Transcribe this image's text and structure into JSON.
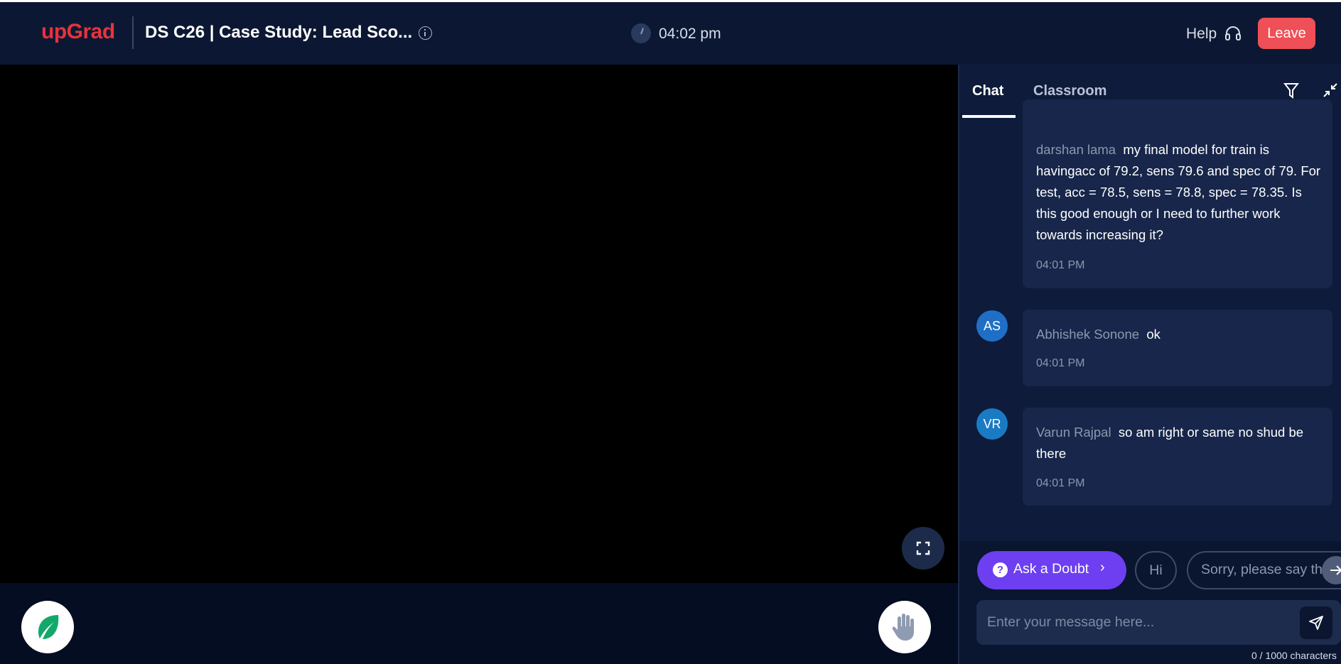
{
  "header": {
    "logo": "upGrad",
    "session_title": "DS C26 | Case Study: Lead Sco...",
    "clock_time": "04:02 pm",
    "help_label": "Help",
    "leave_label": "Leave"
  },
  "icons": {
    "info": "info-icon",
    "clock": "clock-icon",
    "headset": "headset-icon",
    "fullscreen": "fullscreen-icon",
    "leaf": "leaf-icon",
    "hand": "raise-hand-icon",
    "filter": "filter-icon",
    "collapse": "collapse-icon",
    "send": "send-icon",
    "arrow": "arrow-right-icon"
  },
  "colors": {
    "brand": "#e8323c",
    "leave": "#ef4f56",
    "accent_purple": "#6d3ff0",
    "avatar_blue": "#1f6fc7"
  },
  "chat": {
    "tabs": [
      {
        "label": "Chat",
        "active": true
      },
      {
        "label": "Classroom",
        "active": false
      }
    ],
    "messages": [
      {
        "sender": "darshan lama",
        "text": "my final model for train is havingacc of 79.2, sens 79.6 and spec of 79. For test, acc = 78.5, sens = 78.8, spec = 78.35. Is this good enough or I need to further work towards increasing it?",
        "time": "04:01 PM"
      },
      {
        "initials": "AS",
        "sender": "Abhishek Sonone",
        "text": "ok",
        "time": "04:01 PM"
      },
      {
        "initials": "VR",
        "sender": "Varun Rajpal",
        "text": "so am right or same no shud be there",
        "time": "04:01 PM"
      }
    ]
  },
  "composer": {
    "ask_doubt_label": "Ask a Doubt",
    "ask_icon_glyph": "?",
    "ask_chevron": "›",
    "quick_replies": [
      "Hi",
      "Sorry, please say that again"
    ],
    "placeholder": "Enter your message here...",
    "char_count": "0 / 1000 characters"
  }
}
